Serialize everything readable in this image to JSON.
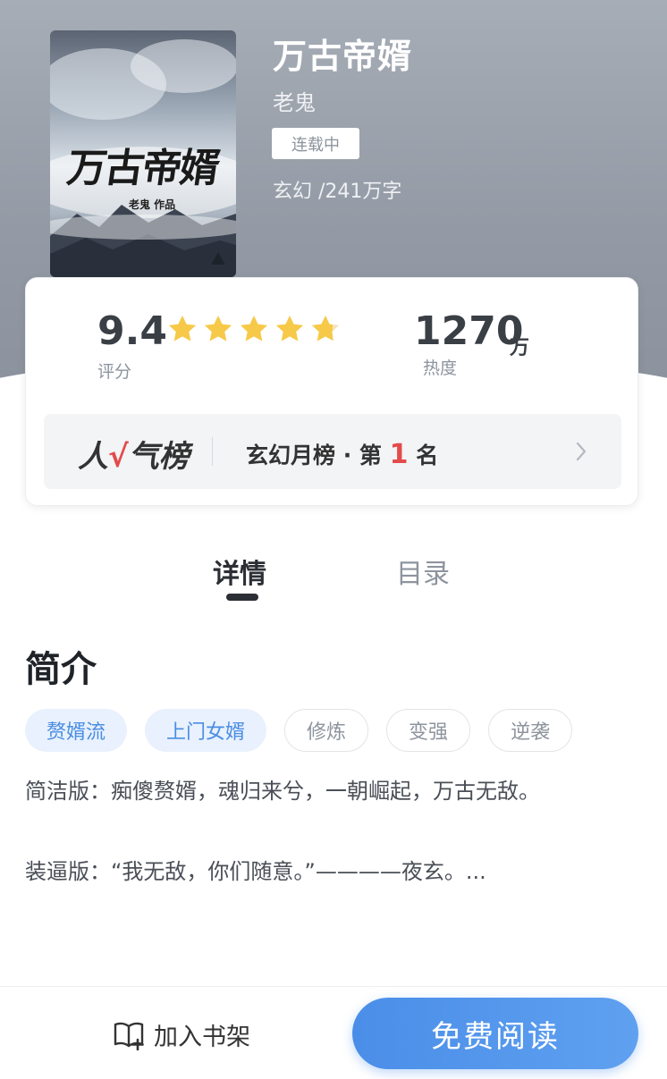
{
  "book": {
    "title": "万古帝婿",
    "author": "老鬼",
    "status": "连载中",
    "meta": "玄幻 /241万字",
    "cover_title": "万古帝婿",
    "cover_author": "老鬼 作品"
  },
  "stats": {
    "score": "9.4",
    "score_label": "评分",
    "rating_stars": 4.7,
    "heat": "1270",
    "heat_unit": "万",
    "heat_label": "热度"
  },
  "rank": {
    "logo_prefix": "人",
    "logo_check": "√",
    "logo_suffix": "气榜",
    "text_prefix": "玄幻月榜 · 第",
    "number": "1",
    "text_suffix": "名"
  },
  "tabs": [
    {
      "label": "详情",
      "active": true
    },
    {
      "label": "目录",
      "active": false
    }
  ],
  "intro": {
    "heading": "简介",
    "tags": [
      "赘婿流",
      "上门女婿",
      "修炼",
      "变强",
      "逆袭"
    ],
    "paragraph1": "简洁版：痴傻赘婿，魂归来兮，一朝崛起，万古无敌。",
    "paragraph2": "装逼版：“我无敌，你们随意。”————夜玄。..."
  },
  "bottom": {
    "shelf_label": "加入书架",
    "read_label": "免费阅读"
  },
  "colors": {
    "accent": "#4a8ee8",
    "rank_red": "#e34b4b",
    "star": "#f7c948"
  }
}
